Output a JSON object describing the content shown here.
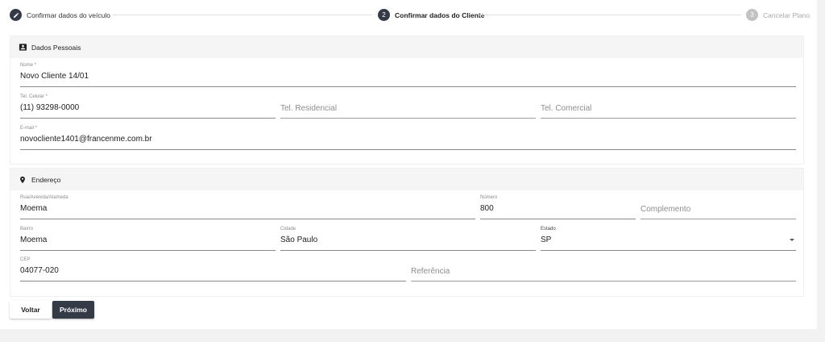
{
  "stepper": {
    "steps": [
      {
        "label": "Confirmar dados do veículo",
        "state": "done"
      },
      {
        "label": "Confirmar dados do Cliente",
        "number": "2",
        "state": "active"
      },
      {
        "label": "Cancelar Plano",
        "number": "3",
        "state": "pending"
      }
    ]
  },
  "personal": {
    "title": "Dados Pessoais",
    "nome": {
      "label": "Nome *",
      "value": "Novo Cliente 14/01"
    },
    "tel_celular": {
      "label": "Tel. Celular *",
      "value": "(11) 93298-0000"
    },
    "tel_residencial": {
      "placeholder": "Tel. Residencial"
    },
    "tel_comercial": {
      "placeholder": "Tel. Comercial"
    },
    "email": {
      "label": "E-mail *",
      "value": "novocliente1401@francenme.com.br"
    }
  },
  "address": {
    "title": "Endereço",
    "rua": {
      "label": "Rua/Avenida/Alameda",
      "value": "Moema"
    },
    "numero": {
      "label": "Número",
      "value": "800"
    },
    "complemento": {
      "placeholder": "Complemento"
    },
    "bairro": {
      "label": "Bairro",
      "value": "Moema"
    },
    "cidade": {
      "label": "Cidade",
      "value": "São Paulo"
    },
    "estado": {
      "label": "Estado",
      "value": "SP"
    },
    "cep": {
      "label": "CEP",
      "value": "04077-020"
    },
    "referencia": {
      "placeholder": "Referência"
    }
  },
  "actions": {
    "back_label": "Voltar",
    "next_label": "Próximo"
  },
  "colors": {
    "primary": "#343a46",
    "header_bg": "#f5f5f5",
    "inactive_step": "#c2c2c2"
  }
}
